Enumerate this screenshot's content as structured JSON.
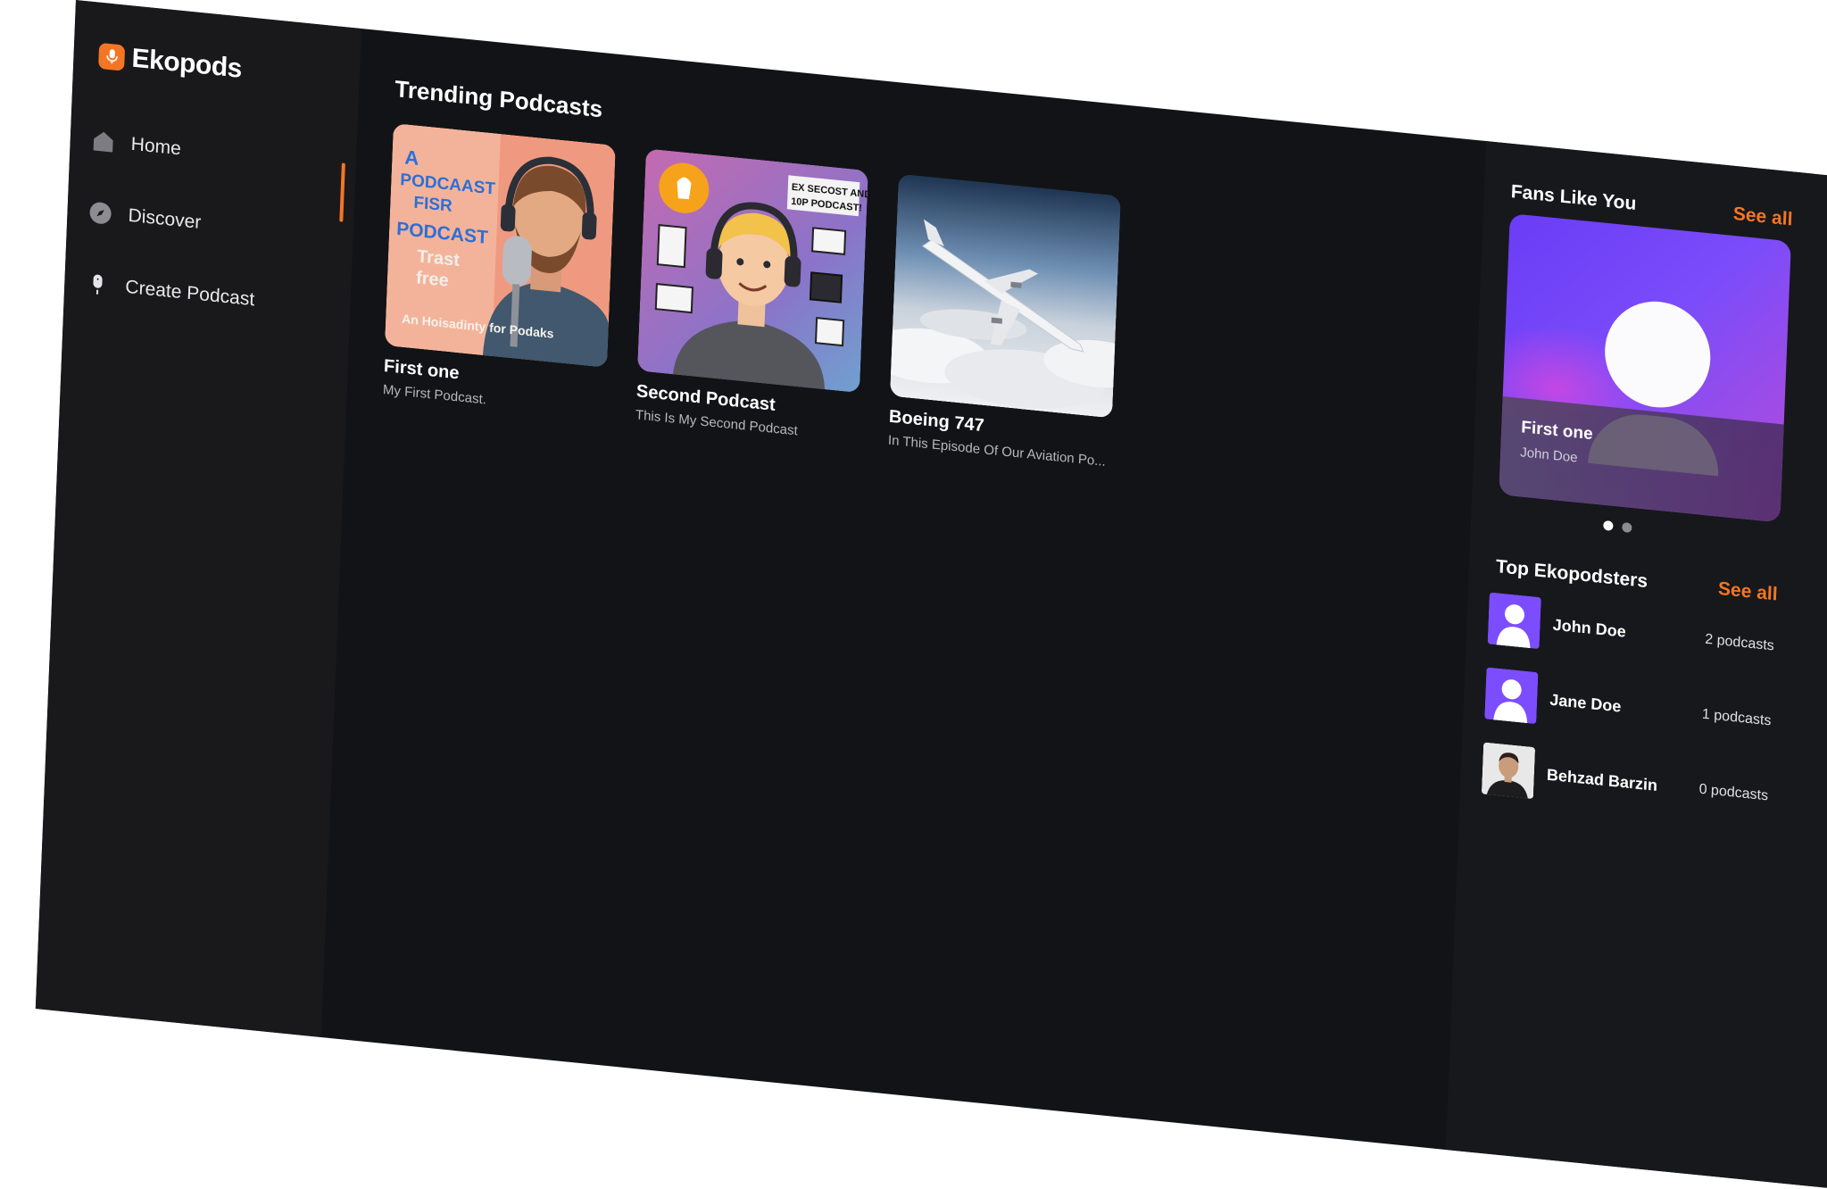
{
  "app": {
    "name": "Ekopods"
  },
  "nav": {
    "items": [
      {
        "label": "Home",
        "icon": "home-icon",
        "active": true
      },
      {
        "label": "Discover",
        "icon": "compass-icon",
        "active": false
      },
      {
        "label": "Create Podcast",
        "icon": "microphone-icon",
        "active": false
      }
    ]
  },
  "trending": {
    "title": "Trending Podcasts",
    "podcasts": [
      {
        "title": "First one",
        "subtitle": "My First Podcast."
      },
      {
        "title": "Second Podcast",
        "subtitle": "This Is My Second Podcast"
      },
      {
        "title": "Boeing 747",
        "subtitle": "In This Episode Of Our Aviation Po..."
      }
    ]
  },
  "fans": {
    "title": "Fans Like You",
    "see_all": "See all",
    "card": {
      "title": "First one",
      "subtitle": "John Doe"
    },
    "carousel_total": 2,
    "carousel_index": 1
  },
  "top_ekopodsters": {
    "title": "Top Ekopodsters",
    "see_all": "See all",
    "users": [
      {
        "name": "John Doe",
        "count": "2 podcasts",
        "avatar": "default-avatar"
      },
      {
        "name": "Jane Doe",
        "count": "1 podcasts",
        "avatar": "default-avatar"
      },
      {
        "name": "Behzad Barzin",
        "count": "0 podcasts",
        "avatar": "photo-avatar"
      }
    ]
  },
  "colors": {
    "accent": "#f37624",
    "background": "#121316",
    "sidebar": "#19191c",
    "avatar_purple": "#7c4dff"
  }
}
